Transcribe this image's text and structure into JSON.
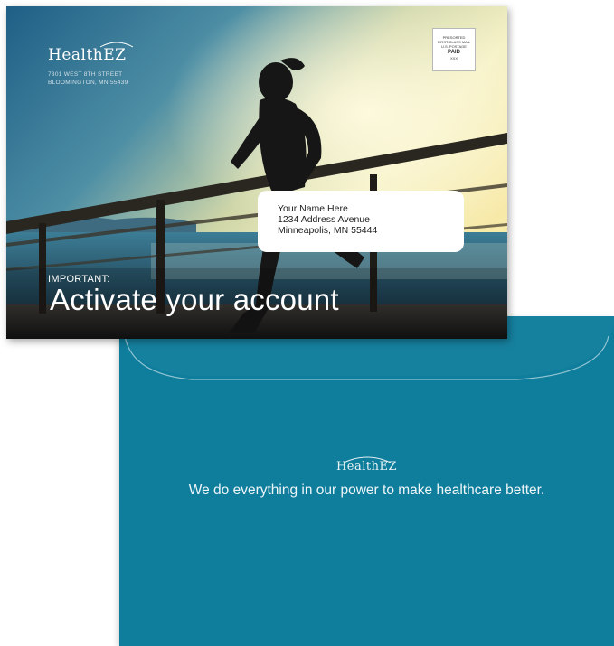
{
  "postcard": {
    "logo": "HealthEZ",
    "return_address": [
      "7301 WEST 8TH STREET",
      "BLOOMINGTON, MN 55439"
    ],
    "postage": {
      "lines_top": [
        "PRESORTED",
        "FIRST-CLASS MAIL",
        "U.S. POSTAGE"
      ],
      "paid": "PAID",
      "line_bottom": "XXX"
    },
    "recipient": {
      "name": "Your Name Here",
      "street": "1234 Address Avenue",
      "city": "Minneapolis, MN 55444"
    },
    "eyebrow": "IMPORTANT:",
    "headline": "Activate your account"
  },
  "envelope": {
    "logo": "HealthEZ",
    "tagline": "We do everything in our power to make healthcare better.",
    "color": "#0f7d9c"
  }
}
